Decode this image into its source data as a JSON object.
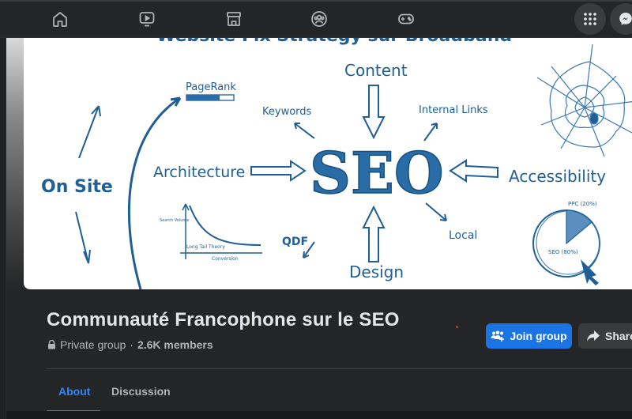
{
  "topnav": {
    "icons": [
      "home-icon",
      "watch-icon",
      "marketplace-icon",
      "groups-icon",
      "gaming-icon"
    ],
    "menu_icon": "menu-grid-icon",
    "messenger_icon": "messenger-icon"
  },
  "cover": {
    "top_text_partial": "Website Fix Strategy sur Broadband",
    "center_word": "SEO",
    "labels": {
      "content": "Content",
      "keywords": "Keywords",
      "internal_links": "Internal Links",
      "architecture": "Architecture",
      "accessibility": "Accessibility",
      "on_site": "On Site",
      "pagerank": "PageRank",
      "qdf": "QDF",
      "local": "Local",
      "design": "Design",
      "ppc": "PPC (20%)",
      "seo_pie": "SEO (80%)",
      "search_volume": "Search Volume",
      "long_tail": "Long Tail Theory",
      "conversion": "Conversion"
    }
  },
  "group": {
    "title": "Communauté Francophone sur le SEO",
    "privacy": "Private group",
    "separator": "·",
    "members": "2.6K members"
  },
  "actions": {
    "join_label": "Join group",
    "share_label": "Share"
  },
  "tabs": [
    {
      "label": "About",
      "active": true
    },
    {
      "label": "Discussion",
      "active": false
    }
  ],
  "colors": {
    "accent": "#2d88ff",
    "join_button": "#1b74e4",
    "background": "#242526",
    "cover_ink": "#1f5f96"
  }
}
